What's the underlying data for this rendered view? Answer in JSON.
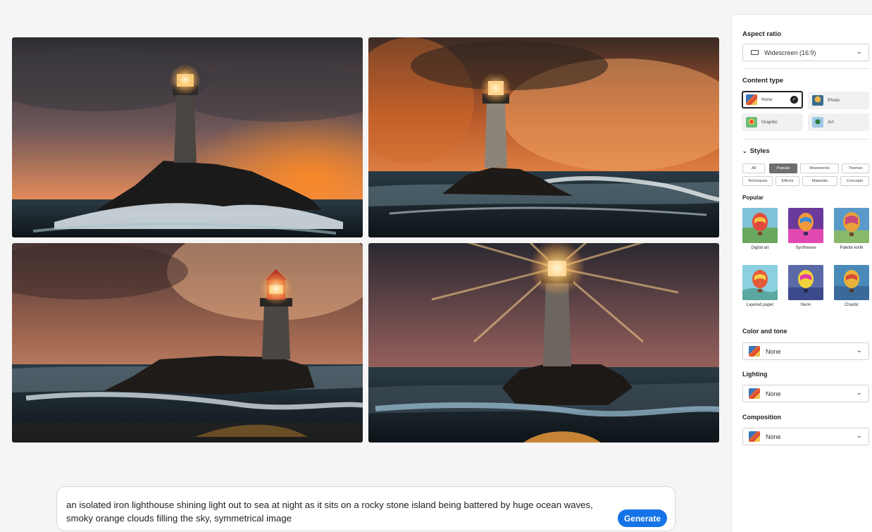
{
  "gallery": {
    "images": [
      {
        "name": "Lighthouse variation 1"
      },
      {
        "name": "Lighthouse variation 2"
      },
      {
        "name": "Lighthouse variation 3"
      },
      {
        "name": "Lighthouse variation 4"
      }
    ]
  },
  "prompt": {
    "text": "an isolated iron lighthouse shining light out to sea at night as it sits on a rocky stone island being battered by huge ocean waves, smoky orange clouds filling the sky, symmetrical image",
    "generate_label": "Generate"
  },
  "panel": {
    "aspect_ratio": {
      "label": "Aspect ratio",
      "value": "Widescreen (16:9)"
    },
    "content_type": {
      "label": "Content type",
      "options": [
        {
          "label": "None",
          "selected": true
        },
        {
          "label": "Photo",
          "selected": false
        },
        {
          "label": "Graphic",
          "selected": false
        },
        {
          "label": "Art",
          "selected": false
        }
      ]
    },
    "styles": {
      "label": "Styles",
      "chips": [
        "All",
        "Popular",
        "Movements",
        "Themes",
        "Techniques",
        "Effects",
        "Materials",
        "Concepts"
      ],
      "active_chip": "Popular",
      "section_label": "Popular",
      "items": [
        "Digital art",
        "Synthwave",
        "Palette knife",
        "Layered paper",
        "Neon",
        "Chaotic"
      ]
    },
    "color_tone": {
      "label": "Color and tone",
      "value": "None"
    },
    "lighting": {
      "label": "Lighting",
      "value": "None"
    },
    "composition": {
      "label": "Composition",
      "value": "None"
    }
  },
  "colors": {
    "accent": "#1473e6",
    "selected_chip": "#6e6e6e"
  }
}
